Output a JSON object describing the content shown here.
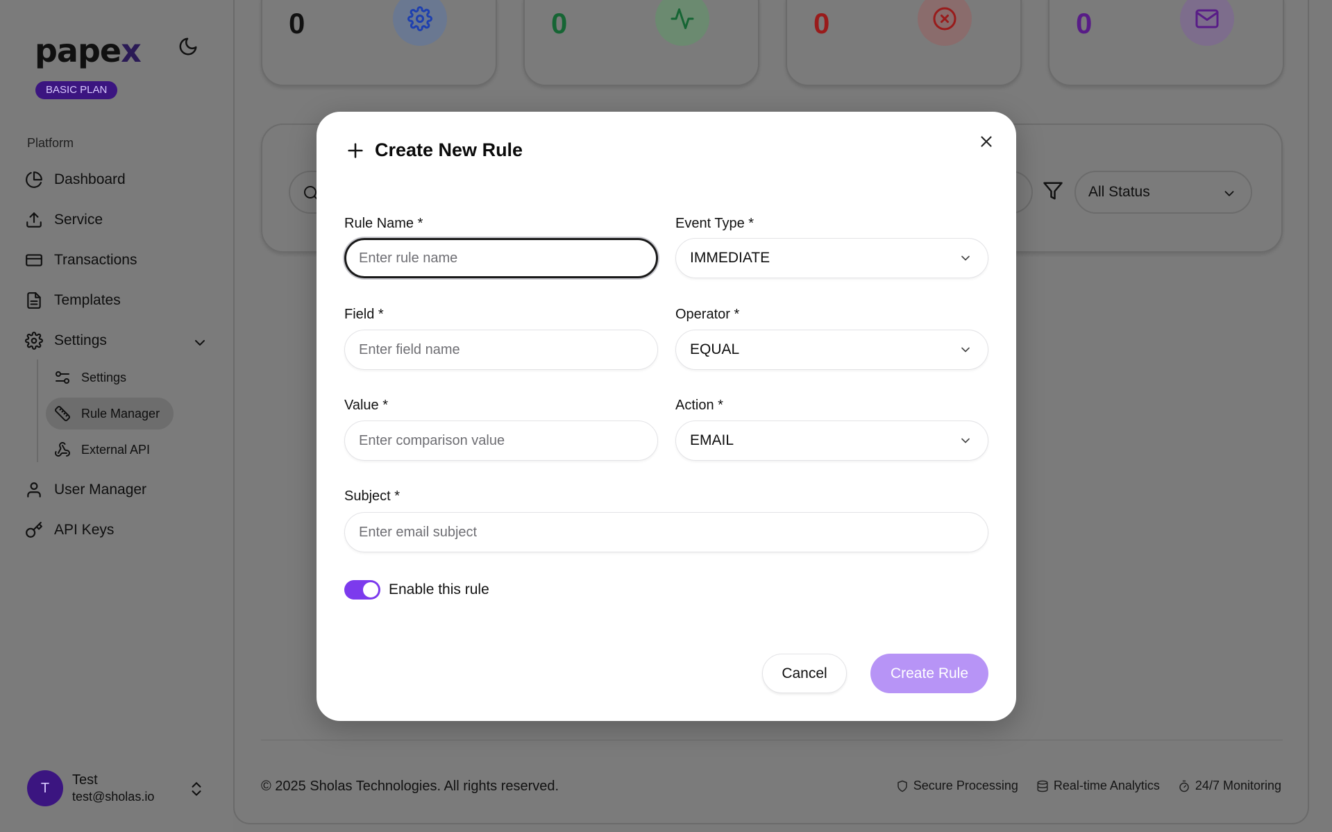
{
  "sidebar": {
    "logo": "pape",
    "logo_accent": "x",
    "plan": "BASIC PLAN",
    "section": "Platform",
    "nav": {
      "dashboard": "Dashboard",
      "service": "Service",
      "transactions": "Transactions",
      "templates": "Templates",
      "settings": "Settings",
      "user_manager": "User Manager",
      "api_keys": "API Keys"
    },
    "sub": {
      "settings": "Settings",
      "rule_manager": "Rule Manager",
      "external_api": "External API"
    },
    "user": {
      "initial": "T",
      "name": "Test",
      "email": "test@sholas.io"
    }
  },
  "stats": [
    {
      "value": "0",
      "color": "#111111",
      "icon": "gear-icon"
    },
    {
      "value": "0",
      "color": "#166534",
      "icon": "activity-icon"
    },
    {
      "value": "0",
      "color": "#991b1b",
      "icon": "x-circle-icon"
    },
    {
      "value": "0",
      "color": "#581c87",
      "icon": "mail-icon"
    }
  ],
  "filters": {
    "status": "All Status"
  },
  "modal": {
    "title": "Create New Rule",
    "rule_name": {
      "label": "Rule Name *",
      "placeholder": "Enter rule name"
    },
    "event_type": {
      "label": "Event Type *",
      "value": "IMMEDIATE"
    },
    "field": {
      "label": "Field *",
      "placeholder": "Enter field name"
    },
    "operator": {
      "label": "Operator *",
      "value": "EQUAL"
    },
    "value": {
      "label": "Value *",
      "placeholder": "Enter comparison value"
    },
    "action": {
      "label": "Action *",
      "value": "EMAIL"
    },
    "subject": {
      "label": "Subject *",
      "placeholder": "Enter email subject"
    },
    "enable": {
      "label": "Enable this rule",
      "on": true
    },
    "cancel": "Cancel",
    "create": "Create Rule"
  },
  "footer": {
    "copyright": "© 2025 Sholas Technologies. All rights reserved.",
    "secure": "Secure Processing",
    "analytics": "Real-time Analytics",
    "monitoring": "24/7 Monitoring"
  }
}
